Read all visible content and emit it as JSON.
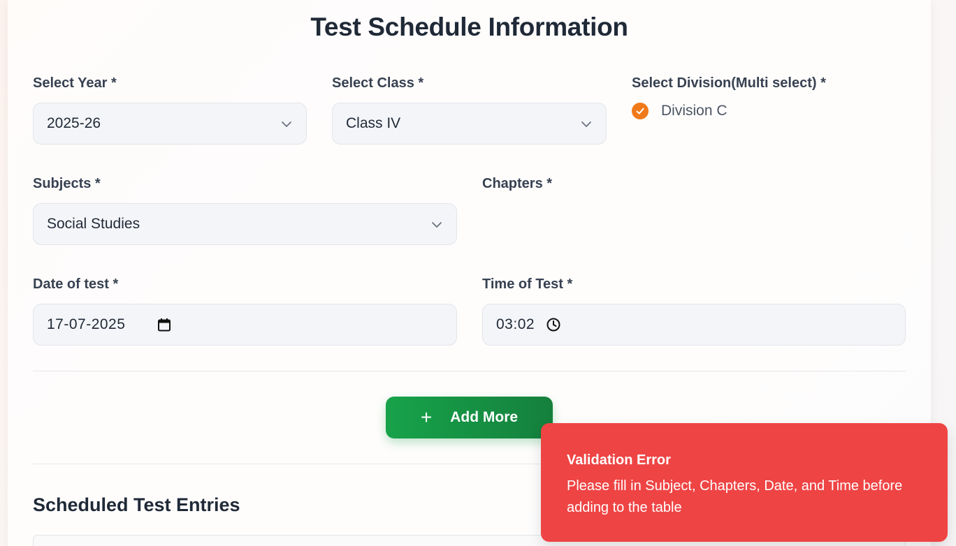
{
  "page": {
    "title": "Test Schedule Information"
  },
  "form": {
    "year": {
      "label": "Select Year *",
      "value": "2025-26"
    },
    "class": {
      "label": "Select Class *",
      "value": "Class IV"
    },
    "division": {
      "label": "Select Division(Multi select) *",
      "options": [
        {
          "label": "Division C",
          "checked": true
        }
      ]
    },
    "subjects": {
      "label": "Subjects *",
      "value": "Social Studies"
    },
    "chapters": {
      "label": "Chapters *"
    },
    "date": {
      "label": "Date of test *",
      "value": "17-07-2025",
      "icon": "calendar-icon"
    },
    "time": {
      "label": "Time of Test *",
      "value": "03:02",
      "icon": "clock-icon"
    }
  },
  "actions": {
    "add_more_label": "Add More",
    "add_more_icon": "plus-icon"
  },
  "entries": {
    "title": "Scheduled Test Entries"
  },
  "toast": {
    "title": "Validation Error",
    "message": "Please fill in Subject, Chapters, Date, and Time before adding to the table"
  },
  "colors": {
    "accent_orange": "#f07a1a",
    "success_green": "#16a34a",
    "error_red": "#ef4444"
  }
}
